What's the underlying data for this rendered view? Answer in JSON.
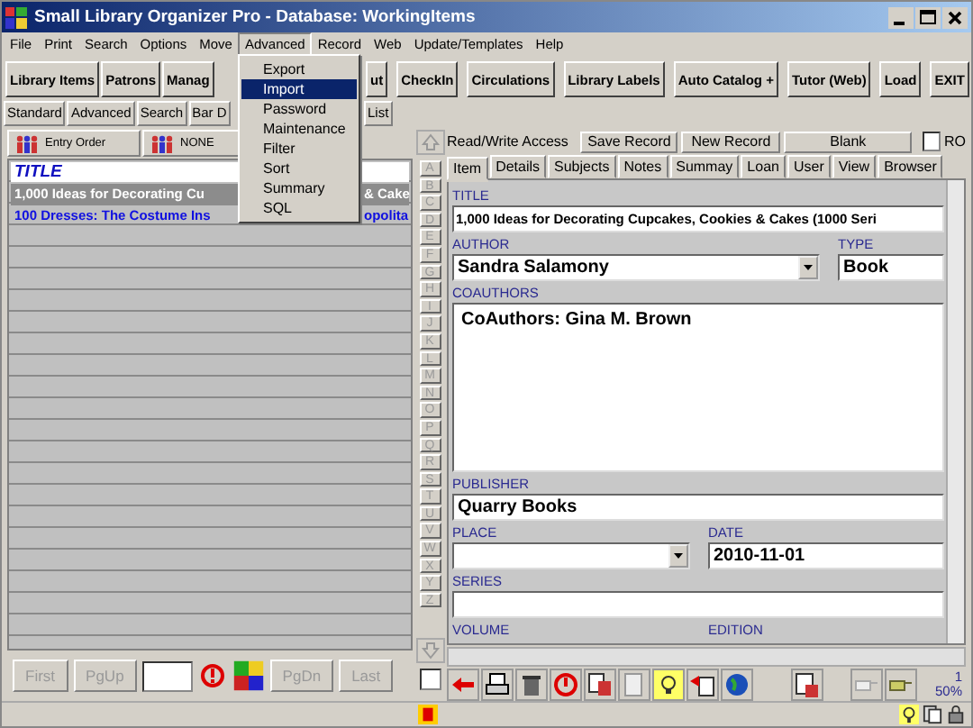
{
  "window": {
    "title": "Small Library Organizer Pro - Database: WorkingItems"
  },
  "menu_bar": [
    {
      "label": "File",
      "open": false
    },
    {
      "label": "Print",
      "open": false
    },
    {
      "label": "Search",
      "open": false
    },
    {
      "label": "Options",
      "open": false
    },
    {
      "label": "Move",
      "open": false
    },
    {
      "label": "Advanced",
      "open": true
    },
    {
      "label": "Record",
      "open": false
    },
    {
      "label": "Web",
      "open": false
    },
    {
      "label": "Update/Templates",
      "open": false
    },
    {
      "label": "Help",
      "open": false
    }
  ],
  "dropdown": [
    {
      "label": "Export",
      "selected": false
    },
    {
      "label": "Import",
      "selected": true
    },
    {
      "label": "Password",
      "selected": false
    },
    {
      "label": "Maintenance",
      "selected": false
    },
    {
      "label": "Filter",
      "selected": false
    },
    {
      "label": "Sort",
      "selected": false
    },
    {
      "label": "Summary",
      "selected": false
    },
    {
      "label": "SQL",
      "selected": false
    }
  ],
  "toolbar": {
    "before_menu": [
      "Library Items",
      "Patrons",
      "Manag"
    ],
    "after_menu": [
      "ut",
      "CheckIn",
      "Circulations",
      "Library Labels",
      "Auto Catalog +",
      "Tutor (Web)",
      "Load",
      "EXIT"
    ]
  },
  "view_tabs": {
    "before_menu": [
      "Standard",
      "Advanced",
      "Search",
      "Bar D"
    ],
    "after_menu": [
      "List"
    ]
  },
  "list_panel": {
    "sort_buttons": [
      "Entry Order",
      "NONE"
    ],
    "column_header": "TITLE",
    "rows": [
      {
        "left": "1,000 Ideas for Decorating Cu",
        "right": "& Cake",
        "selected": true
      },
      {
        "left": "100 Dresses: The Costume Ins",
        "right": "opolita",
        "selected": false
      }
    ],
    "nav": {
      "first": "First",
      "pgup": "PgUp",
      "pgdn": "PgDn",
      "last": "Last"
    }
  },
  "alpha_checkbox": {
    "checked": false
  },
  "alphabet": [
    "A",
    "B",
    "C",
    "D",
    "E",
    "F",
    "G",
    "H",
    "I",
    "J",
    "K",
    "L",
    "M",
    "N",
    "O",
    "P",
    "Q",
    "R",
    "S",
    "T",
    "U",
    "V",
    "W",
    "X",
    "Y",
    "Z"
  ],
  "record": {
    "access": "Read/Write Access",
    "buttons": [
      "Save Record",
      "New Record",
      "Blank"
    ],
    "ro": {
      "label": "RO",
      "checked": false
    },
    "tabs": [
      {
        "label": "Item",
        "selected": true
      },
      {
        "label": "Details",
        "selected": false
      },
      {
        "label": "Subjects",
        "selected": false
      },
      {
        "label": "Notes",
        "selected": false
      },
      {
        "label": "Summay",
        "selected": false
      },
      {
        "label": "Loan",
        "selected": false
      },
      {
        "label": "User",
        "selected": false
      },
      {
        "label": "View",
        "selected": false
      },
      {
        "label": "Browser",
        "selected": false
      }
    ],
    "title": {
      "label": "TITLE",
      "value": "1,000 Ideas for Decorating Cupcakes, Cookies & Cakes (1000 Seri"
    },
    "author": {
      "label": "AUTHOR",
      "value": "Sandra Salamony"
    },
    "type": {
      "label": "TYPE",
      "value": "Book"
    },
    "coauthors": {
      "label": "COAUTHORS",
      "value": "CoAuthors: Gina M. Brown"
    },
    "publisher": {
      "label": "PUBLISHER",
      "value": "Quarry Books"
    },
    "place": {
      "label": "PLACE"
    },
    "date": {
      "label": "DATE",
      "value": "2010-11-01"
    },
    "series": {
      "label": "SERIES"
    },
    "volume": {
      "label": "VOLUME"
    },
    "edition": {
      "label": "EDITION"
    }
  },
  "status": {
    "record_number": "1",
    "percent": "50%"
  }
}
